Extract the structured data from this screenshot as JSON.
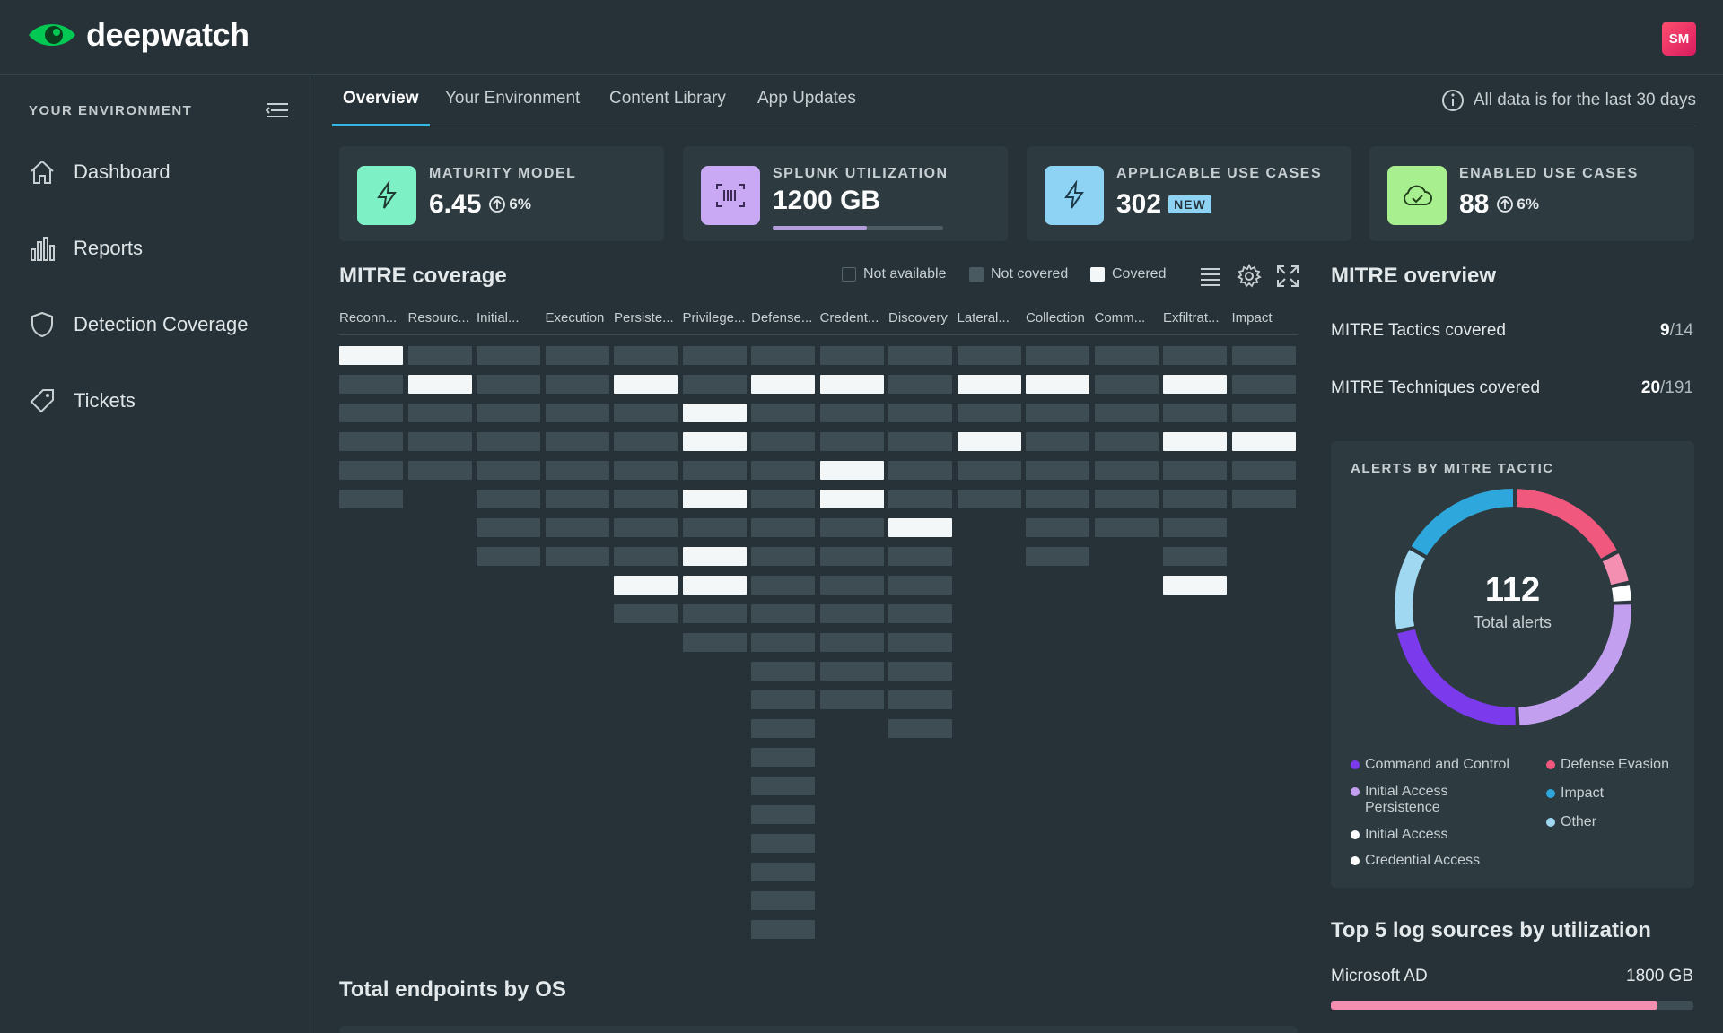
{
  "app": {
    "name": "deepwatch",
    "brand_color": "#00c853"
  },
  "user": {
    "initials": "SM"
  },
  "sidebar": {
    "header": "YOUR ENVIRONMENT",
    "items": [
      {
        "label": "Dashboard",
        "icon": "home-icon"
      },
      {
        "label": "Reports",
        "icon": "bar-chart-icon"
      },
      {
        "label": "Detection Coverage",
        "icon": "shield-icon"
      },
      {
        "label": "Tickets",
        "icon": "tag-icon"
      }
    ]
  },
  "tabs": {
    "items": [
      "Overview",
      "Your Environment",
      "Content Library",
      "App Updates"
    ],
    "active": "Overview",
    "note": "All data is for the last 30 days"
  },
  "kpis": {
    "maturity": {
      "label": "MATURITY MODEL",
      "value": "6.45",
      "delta": "6%",
      "icon_color": "#7ef0c6"
    },
    "splunk": {
      "label": "SPLUNK UTILIZATION",
      "value": "1200 GB",
      "fill": 0.55,
      "icon_color": "#c9a8f4"
    },
    "applicable": {
      "label": "APPLICABLE USE CASES",
      "value": "302",
      "badge": "NEW",
      "icon_color": "#8fd3f4"
    },
    "enabled": {
      "label": "ENABLED USE CASES",
      "value": "88",
      "delta": "6%",
      "icon_color": "#a8f08f"
    }
  },
  "mitre": {
    "title": "MITRE coverage",
    "legend": {
      "not_available": "Not available",
      "not_covered": "Not covered",
      "covered": "Covered"
    },
    "columns": [
      {
        "label": "Reconn...",
        "cells": 6,
        "covered": [
          0
        ]
      },
      {
        "label": "Resourc...",
        "cells": 5,
        "covered": [
          1
        ]
      },
      {
        "label": "Initial...",
        "cells": 8,
        "covered": []
      },
      {
        "label": "Execution",
        "cells": 8,
        "covered": []
      },
      {
        "label": "Persiste...",
        "cells": 10,
        "covered": [
          1,
          8
        ]
      },
      {
        "label": "Privilege...",
        "cells": 11,
        "covered": [
          2,
          3,
          5,
          7,
          8
        ]
      },
      {
        "label": "Defense...",
        "cells": 21,
        "covered": [
          1
        ]
      },
      {
        "label": "Credent...",
        "cells": 13,
        "covered": [
          1,
          4,
          5
        ]
      },
      {
        "label": "Discovery",
        "cells": 14,
        "covered": [
          6
        ]
      },
      {
        "label": "Lateral...",
        "cells": 6,
        "covered": [
          1,
          3
        ]
      },
      {
        "label": "Collection",
        "cells": 8,
        "covered": [
          1
        ]
      },
      {
        "label": "Comm...",
        "cells": 7,
        "covered": []
      },
      {
        "label": "Exfiltrat...",
        "cells": 9,
        "covered": [
          1,
          3,
          8
        ]
      },
      {
        "label": "Impact",
        "cells": 6,
        "covered": [
          3
        ]
      }
    ]
  },
  "overview": {
    "title": "MITRE overview",
    "tactics": {
      "label": "MITRE Tactics covered",
      "covered": "9",
      "total": "/14"
    },
    "techniques": {
      "label": "MITRE Techniques covered",
      "covered": "20",
      "total": "/191"
    }
  },
  "alerts": {
    "title": "ALERTS BY MITRE TACTIC",
    "total": "112",
    "total_label": "Total alerts",
    "segments": [
      {
        "name": "Defense Evasion",
        "value": 19,
        "color": "#f0587e"
      },
      {
        "name": "Defense Evasion",
        "value": 5,
        "color": "#f48fb1"
      },
      {
        "name": "Credential Access",
        "value": 3,
        "color": "#ffffff"
      },
      {
        "name": "Initial Access Persistence",
        "value": 28,
        "color": "#c39ff0"
      },
      {
        "name": "Command and Control",
        "value": 25,
        "color": "#7c3aed"
      },
      {
        "name": "Other",
        "value": 13,
        "color": "#9fd8f0"
      },
      {
        "name": "Impact",
        "value": 19,
        "color": "#2ea8dc"
      }
    ],
    "legend": [
      {
        "label": "Command and Control",
        "color": "#7c3aed"
      },
      {
        "label": "Defense Evasion",
        "color": "#f0587e"
      },
      {
        "label": "Initial Access Persistence",
        "color": "#c39ff0"
      },
      {
        "label": "Impact",
        "color": "#2ea8dc"
      },
      {
        "label": "Other",
        "color": "#9fd8f0"
      },
      {
        "label": "Initial Access",
        "color": "#ffffff"
      },
      {
        "label": "Credential Access",
        "color": "#ffffff"
      }
    ]
  },
  "logs": {
    "title": "Top 5 log sources by utilization",
    "items": [
      {
        "name": "Microsoft AD",
        "value": "1800 GB",
        "fill": 0.9
      }
    ]
  },
  "endpoints": {
    "title": "Total endpoints by OS"
  }
}
